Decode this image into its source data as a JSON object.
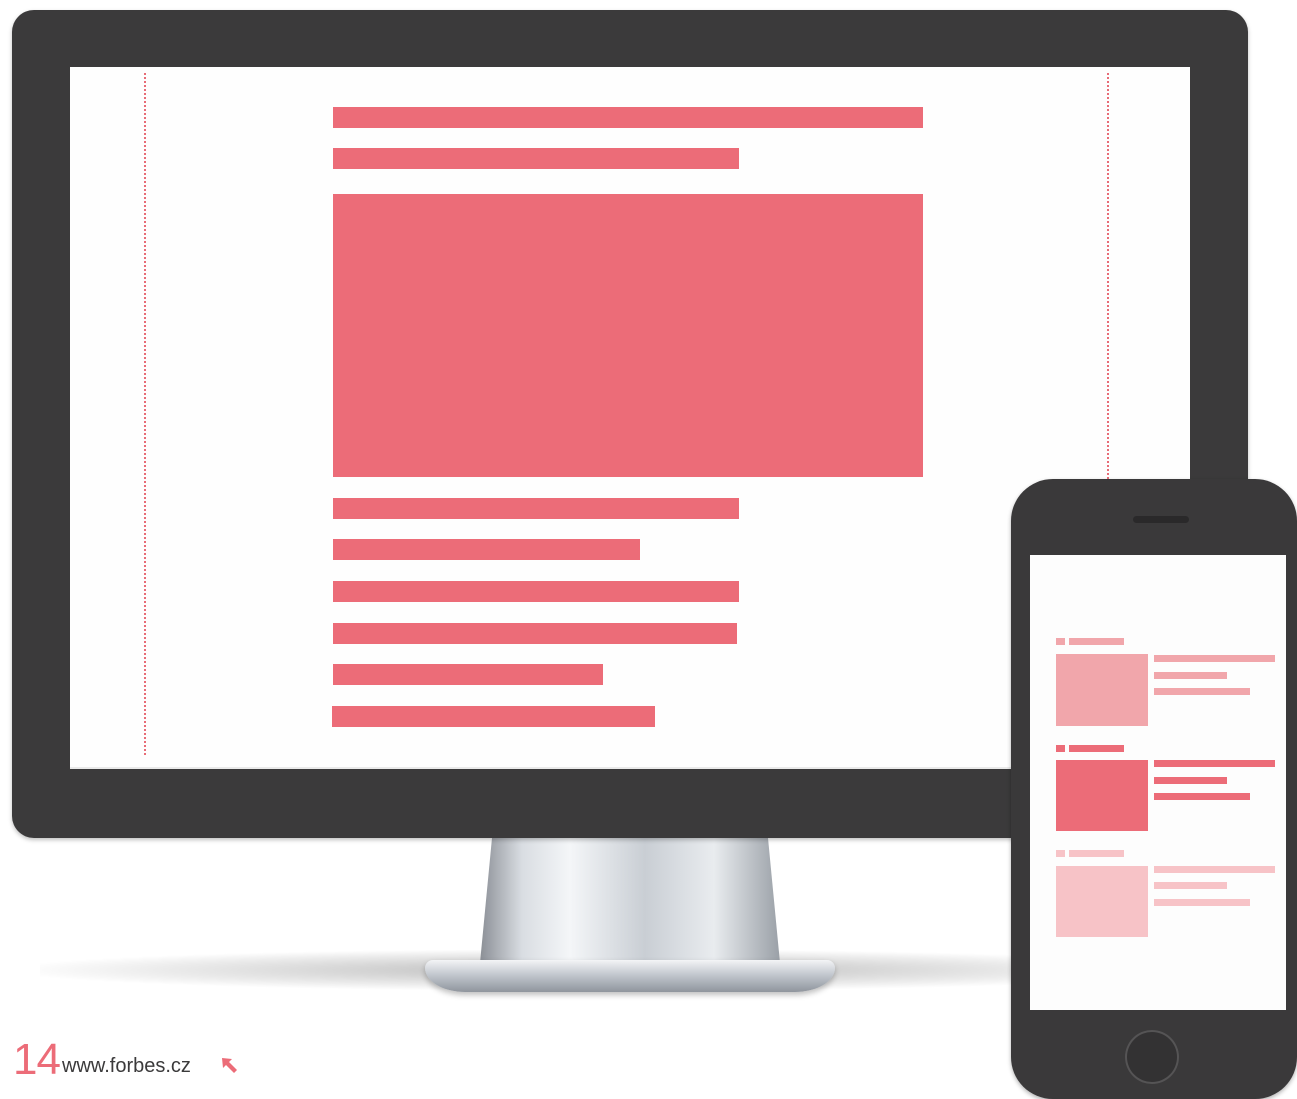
{
  "colors": {
    "accent": "#ec6c78",
    "accent_light": "#f1a6ab",
    "accent_lighter": "#f7c3c7",
    "device_frame": "#3b3a3b"
  },
  "footer": {
    "page_number": "14",
    "url": "www.forbes.cz",
    "icon": "arrow-up-left-icon"
  },
  "desktop_layout": {
    "blocks": [
      "headline-bar",
      "subheadline-bar",
      "hero-image",
      "text-line",
      "text-line",
      "text-line",
      "text-line",
      "text-line",
      "text-line"
    ]
  },
  "mobile_layout": {
    "cards": [
      {
        "tone": "light"
      },
      {
        "tone": "strong"
      },
      {
        "tone": "pale"
      }
    ]
  }
}
